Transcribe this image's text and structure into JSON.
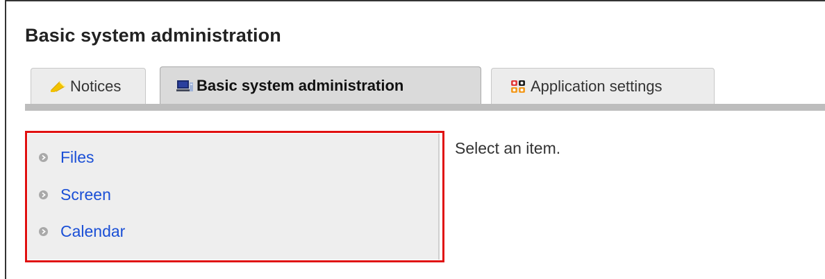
{
  "page": {
    "title": "Basic system administration"
  },
  "tabs": [
    {
      "label": "Notices",
      "icon": "notices-icon",
      "active": false
    },
    {
      "label": "Basic system administration",
      "icon": "computer-icon",
      "active": true
    },
    {
      "label": "Application settings",
      "icon": "apps-grid-icon",
      "active": false
    }
  ],
  "menu": {
    "items": [
      {
        "label": "Files",
        "icon": "bullet-icon"
      },
      {
        "label": "Screen",
        "icon": "bullet-icon"
      },
      {
        "label": "Calendar",
        "icon": "bullet-icon"
      }
    ],
    "highlight_color": "#e01010",
    "link_color": "#1a4fd6"
  },
  "content": {
    "prompt": "Select an item."
  }
}
